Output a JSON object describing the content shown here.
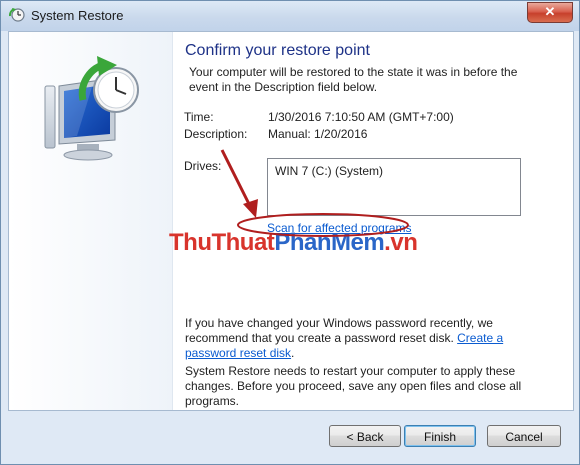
{
  "window": {
    "title": "System Restore",
    "close_glyph": "✕"
  },
  "page": {
    "heading": "Confirm your restore point",
    "intro": "Your computer will be restored to the state it was in before the event in the Description field below.",
    "time_label": "Time:",
    "time_value": "1/30/2016 7:10:50 AM (GMT+7:00)",
    "description_label": "Description:",
    "description_value": "Manual: 1/20/2016",
    "drives_label": "Drives:",
    "drives": [
      "WIN 7 (C:) (System)"
    ],
    "scan_link": "Scan for affected programs",
    "watermark_part1": "ThuThuat",
    "watermark_part2": "PhanMem",
    "watermark_part3": ".vn",
    "password_text": "If you have changed your Windows password recently, we recommend that you create a password reset disk. ",
    "password_link": "Create a password reset disk",
    "password_end": ".",
    "restart_text": "System Restore needs to restart your computer to apply these changes. Before you proceed, save any open files and close all programs."
  },
  "buttons": {
    "back": "< Back",
    "finish": "Finish",
    "cancel": "Cancel"
  },
  "icons": {
    "app": "system-restore-icon",
    "hero": "restore-computer-clock-icon",
    "annotation": "red-arrow-icon"
  },
  "colors": {
    "heading": "#1e3287",
    "link": "#0a5bd0",
    "annotation": "#b01e1e",
    "watermark_red": "#d8342c",
    "watermark_blue": "#2a66c8"
  }
}
